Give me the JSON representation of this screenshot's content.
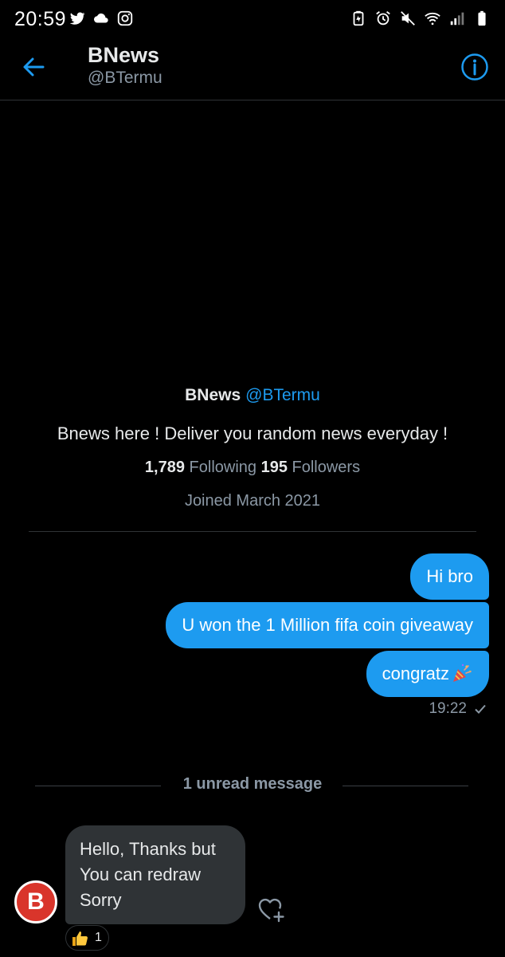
{
  "status_bar": {
    "time": "20:59",
    "left_icons": [
      "twitter-icon",
      "cloud-icon",
      "instagram-icon"
    ],
    "right_icons": [
      "battery-saver-icon",
      "alarm-icon",
      "mute-icon",
      "wifi-icon",
      "signal-icon",
      "battery-icon"
    ]
  },
  "header": {
    "title": "BNews",
    "handle": "@BTermu",
    "back_icon": "back-arrow-icon",
    "info_icon": "info-icon"
  },
  "profile": {
    "name": "BNews",
    "handle": "@BTermu",
    "bio": "Bnews here ! Deliver you random news everyday !",
    "following_count": "1,789",
    "following_label": "Following",
    "followers_count": "195",
    "followers_label": "Followers",
    "joined": "Joined March 2021"
  },
  "conversation": {
    "outgoing": [
      {
        "text": "Hi bro"
      },
      {
        "text": "U won the 1 Million fifa coin giveaway"
      },
      {
        "text": "congratz",
        "emoji": "party-popper-icon"
      }
    ],
    "outgoing_time": "19:22",
    "unread_label": "1 unread message",
    "incoming": {
      "avatar_letter": "B",
      "lines": [
        "Hello, Thanks but",
        "You can redraw",
        "Sorry"
      ],
      "reaction_emoji": "thumbs-up-icon",
      "reaction_count": "1"
    }
  },
  "colors": {
    "background": "#000000",
    "accent": "#1d9bf0",
    "incoming_bubble": "#2f3336",
    "muted_text": "#8b98a5",
    "avatar": "#d9352b"
  }
}
